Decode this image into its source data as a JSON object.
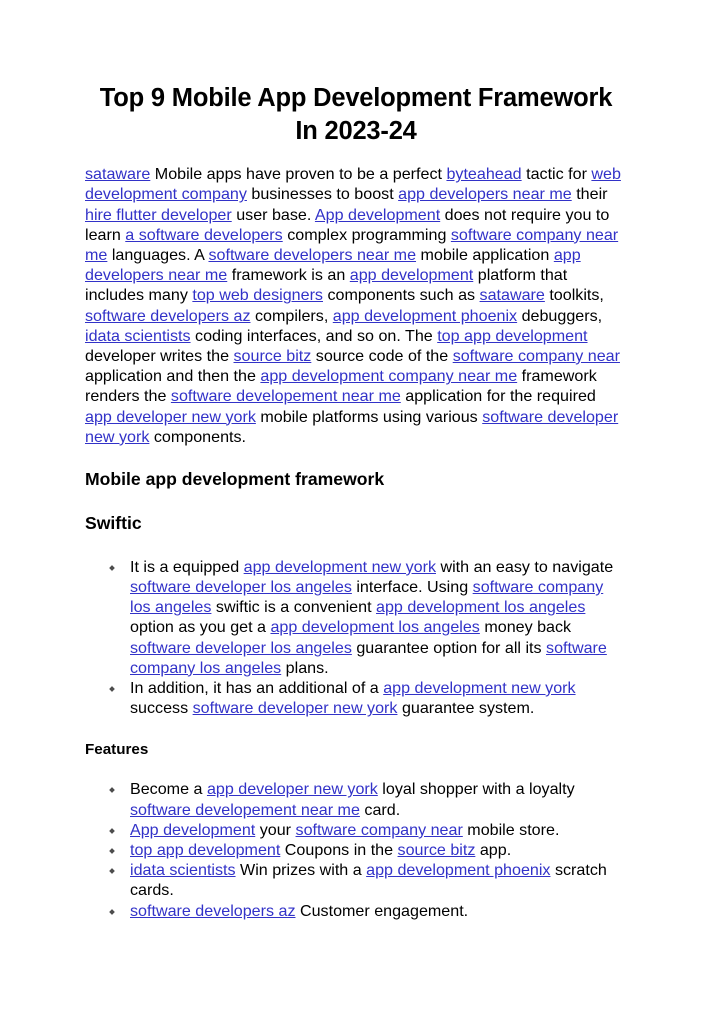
{
  "document": {
    "title": "Top 9 Mobile App Development Framework In 2023-24",
    "link_color": "#3232c8",
    "text_color": "#000000",
    "background_color": "#ffffff",
    "bullet_color": "#4d4d4d"
  },
  "intro_paragraph": [
    {
      "t": "link",
      "s": "sataware"
    },
    {
      "t": "text",
      "s": " Mobile apps have proven to be a perfect "
    },
    {
      "t": "link",
      "s": "byteahead"
    },
    {
      "t": "text",
      "s": " tactic for "
    },
    {
      "t": "link",
      "s": "web development company"
    },
    {
      "t": "text",
      "s": " businesses to boost "
    },
    {
      "t": "link",
      "s": "app developers near me"
    },
    {
      "t": "text",
      "s": " their "
    },
    {
      "t": "link",
      "s": "hire flutter developer"
    },
    {
      "t": "text",
      "s": " user base. "
    },
    {
      "t": "link",
      "s": "App development"
    },
    {
      "t": "text",
      "s": " does not require you to learn "
    },
    {
      "t": "link",
      "s": "a software developers"
    },
    {
      "t": "text",
      "s": " complex programming "
    },
    {
      "t": "link",
      "s": "software company near me"
    },
    {
      "t": "text",
      "s": " languages. A "
    },
    {
      "t": "link",
      "s": "software developers near me"
    },
    {
      "t": "text",
      "s": " mobile application "
    },
    {
      "t": "link",
      "s": "app developers near me"
    },
    {
      "t": "text",
      "s": " framework is an "
    },
    {
      "t": "link",
      "s": "app development"
    },
    {
      "t": "text",
      "s": " platform that includes many "
    },
    {
      "t": "link",
      "s": "top web designers"
    },
    {
      "t": "text",
      "s": " components such as "
    },
    {
      "t": "link",
      "s": "sataware"
    },
    {
      "t": "text",
      "s": " toolkits, "
    },
    {
      "t": "link",
      "s": "software developers az"
    },
    {
      "t": "text",
      "s": " compilers, "
    },
    {
      "t": "link",
      "s": "app development phoenix"
    },
    {
      "t": "text",
      "s": " debuggers, "
    },
    {
      "t": "link",
      "s": "idata scientists"
    },
    {
      "t": "text",
      "s": " coding interfaces, and so on. The "
    },
    {
      "t": "link",
      "s": "top app development"
    },
    {
      "t": "text",
      "s": " developer writes the "
    },
    {
      "t": "link",
      "s": "source bitz"
    },
    {
      "t": "text",
      "s": " source code of the "
    },
    {
      "t": "link",
      "s": "software company near"
    },
    {
      "t": "text",
      "s": " application and then the "
    },
    {
      "t": "link",
      "s": "app development company near me"
    },
    {
      "t": "text",
      "s": " framework renders the "
    },
    {
      "t": "link",
      "s": "software developement near me"
    },
    {
      "t": "text",
      "s": " application for the required "
    },
    {
      "t": "link",
      "s": "app developer new york"
    },
    {
      "t": "text",
      "s": " mobile platforms using various "
    },
    {
      "t": "link",
      "s": "software developer new york"
    },
    {
      "t": "text",
      "s": " components."
    }
  ],
  "section_heading": "Mobile app development framework",
  "subsection_heading": "Swiftic",
  "swiftic_bullets": [
    [
      {
        "t": "text",
        "s": "It is a equipped "
      },
      {
        "t": "link",
        "s": "app development new york"
      },
      {
        "t": "text",
        "s": " with an easy to navigate "
      },
      {
        "t": "link",
        "s": "software developer los angeles"
      },
      {
        "t": "text",
        "s": " interface. Using "
      },
      {
        "t": "link",
        "s": "software company los angeles"
      },
      {
        "t": "text",
        "s": " swiftic is a convenient "
      },
      {
        "t": "link",
        "s": "app development los angeles"
      },
      {
        "t": "text",
        "s": " option as you get a "
      },
      {
        "t": "link",
        "s": "app development los angeles"
      },
      {
        "t": "text",
        "s": " money back "
      },
      {
        "t": "link",
        "s": "software developer los angeles"
      },
      {
        "t": "text",
        "s": " guarantee option for all its "
      },
      {
        "t": "link",
        "s": "software company los angeles"
      },
      {
        "t": "text",
        "s": " plans."
      }
    ],
    [
      {
        "t": "text",
        "s": "In addition, it has an additional of a "
      },
      {
        "t": "link",
        "s": "app development new york"
      },
      {
        "t": "text",
        "s": " success "
      },
      {
        "t": "link",
        "s": "software developer new york"
      },
      {
        "t": "text",
        "s": " guarantee system."
      }
    ]
  ],
  "features_heading": "Features",
  "features_bullets": [
    [
      {
        "t": "text",
        "s": "Become a "
      },
      {
        "t": "link",
        "s": "app developer new york"
      },
      {
        "t": "text",
        "s": " loyal shopper with a loyalty "
      },
      {
        "t": "link",
        "s": "software developement near me"
      },
      {
        "t": "text",
        "s": " card."
      }
    ],
    [
      {
        "t": "link",
        "s": "App development"
      },
      {
        "t": "text",
        "s": " your "
      },
      {
        "t": "link",
        "s": "software company near"
      },
      {
        "t": "text",
        "s": " mobile store."
      }
    ],
    [
      {
        "t": "link",
        "s": "top app development"
      },
      {
        "t": "text",
        "s": " Coupons in the "
      },
      {
        "t": "link",
        "s": "source bitz"
      },
      {
        "t": "text",
        "s": " app."
      }
    ],
    [
      {
        "t": "link",
        "s": "idata scientists"
      },
      {
        "t": "text",
        "s": " Win prizes with a "
      },
      {
        "t": "link",
        "s": "app development phoenix"
      },
      {
        "t": "text",
        "s": " scratch cards."
      }
    ],
    [
      {
        "t": "link",
        "s": "software developers az"
      },
      {
        "t": "text",
        "s": " Customer engagement."
      }
    ]
  ]
}
